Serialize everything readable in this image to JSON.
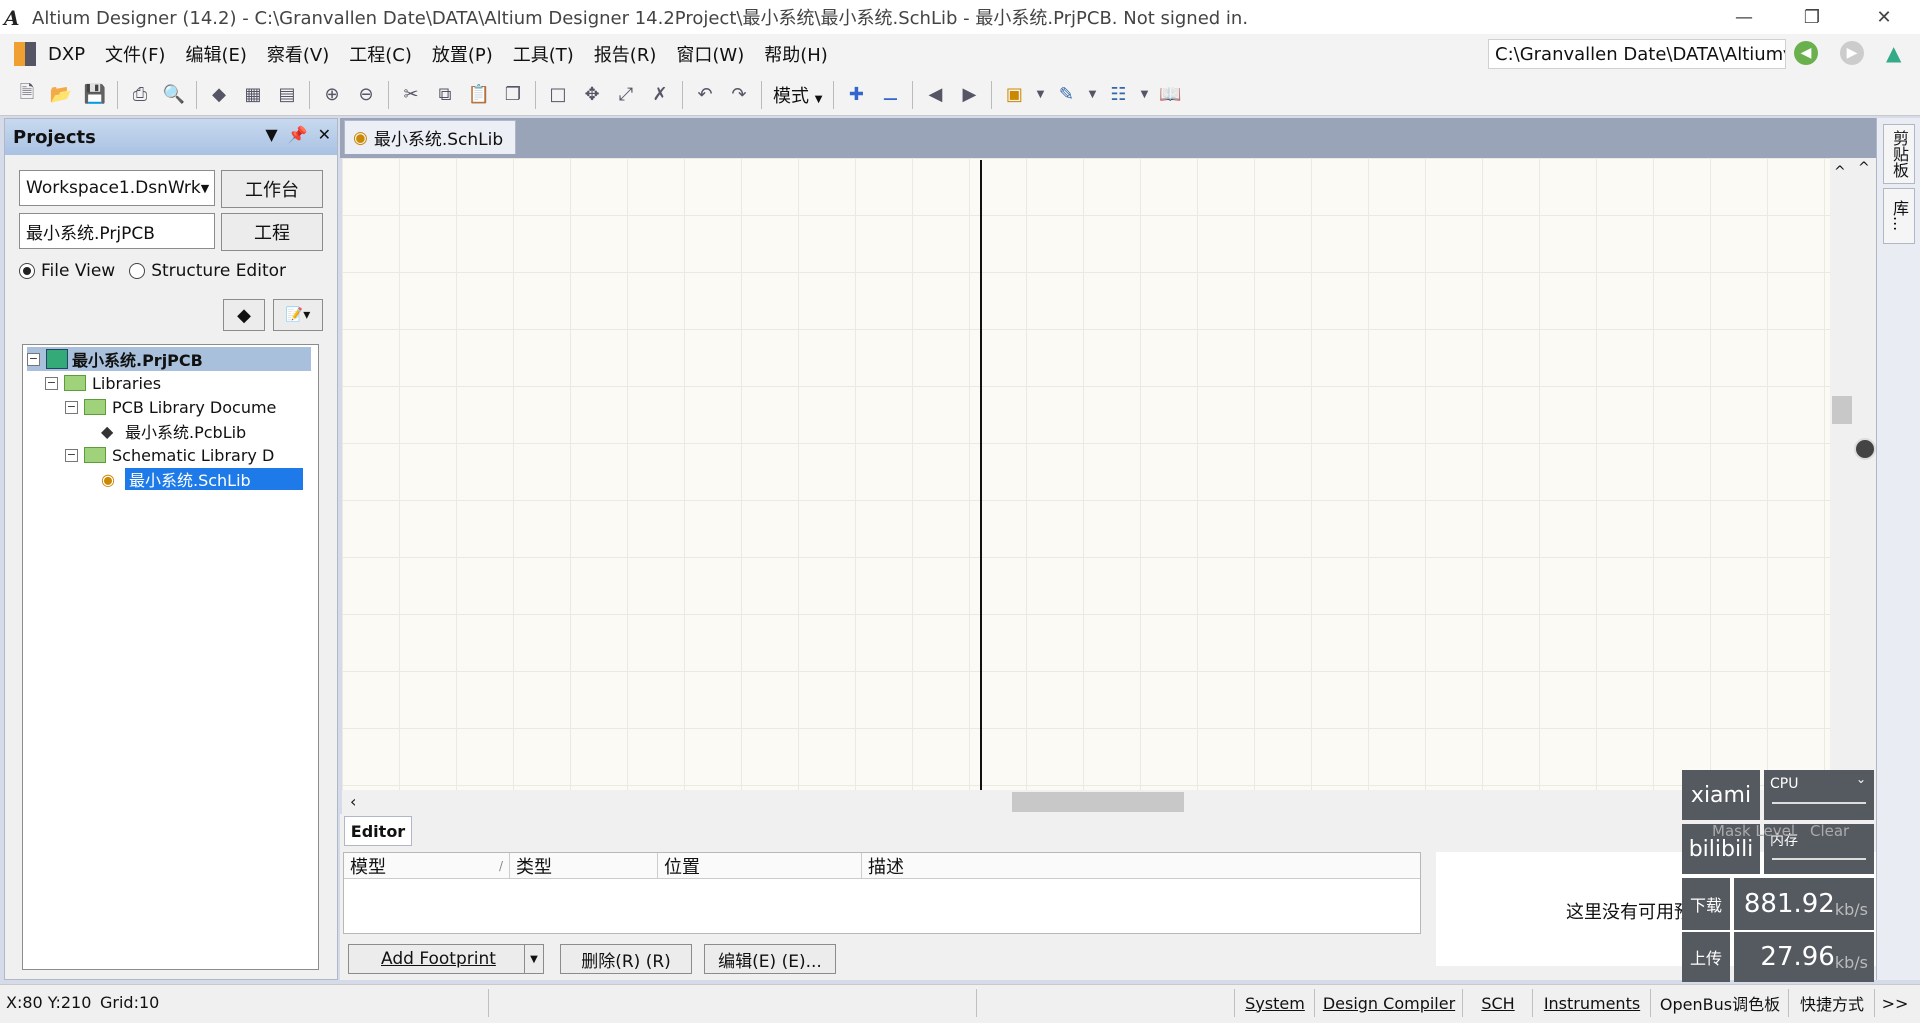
{
  "window": {
    "title": "Altium Designer (14.2) - C:\\Granvallen Date\\DATA\\Altium Designer 14.2Project\\最小系统\\最小系统.SchLib - 最小系统.PrjPCB. Not signed in.",
    "logo": "A"
  },
  "menu": {
    "items": [
      "DXP",
      "文件(F)",
      "编辑(E)",
      "察看(V)",
      "工程(C)",
      "放置(P)",
      "工具(T)",
      "报告(R)",
      "窗口(W)",
      "帮助(H)"
    ],
    "path": "C:\\Granvallen Date\\DATA\\Altium"
  },
  "toolbar": {
    "mode_label": "模式"
  },
  "projects_panel": {
    "title": "Projects",
    "workspace": "Workspace1.DsnWrk",
    "workspace_button": "工作台",
    "project": "最小系统.PrjPCB",
    "project_button": "工程",
    "radio_file_view": "File View",
    "radio_structure_editor": "Structure Editor",
    "tree": {
      "root": "最小系统.PrjPCB",
      "libraries": "Libraries",
      "pcb_folder": "PCB Library Docume",
      "pcb_lib": "最小系统.PcbLib",
      "sch_folder": "Schematic Library D",
      "sch_lib": "最小系统.SchLib"
    }
  },
  "document_tab": {
    "label": "最小系统.SchLib"
  },
  "editor": {
    "tab": "Editor",
    "columns": [
      "模型",
      "类型",
      "位置",
      "描述"
    ],
    "add_footprint": "Add Footprint",
    "delete": "删除(R) (R)",
    "edit": "编辑(E) (E)...",
    "no_preview": "这里没有可用预览"
  },
  "right_tabs": [
    "剪贴板",
    "库..."
  ],
  "monitor": {
    "xiami": "xiami",
    "bilibili": "bilibili",
    "cpu": "CPU",
    "memory": "内存",
    "mask_level": "Mask Level",
    "clear": "Clear",
    "download_label": "下载",
    "download_value": "881.92",
    "upload_label": "上传",
    "upload_value": "27.96",
    "unit": "kb/s"
  },
  "status": {
    "coords": "X:80 Y:210",
    "grid": "Grid:10",
    "tabs": [
      "System",
      "Design Compiler",
      "SCH",
      "Instruments",
      "OpenBus调色板",
      "快捷方式"
    ],
    "more": ">>"
  }
}
